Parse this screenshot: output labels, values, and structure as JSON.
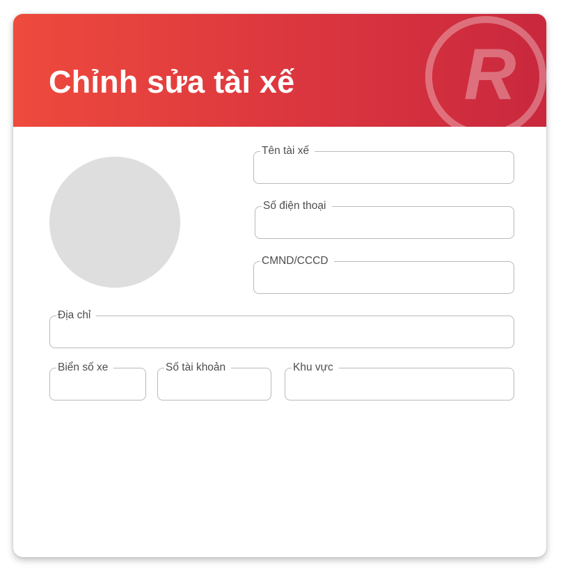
{
  "header": {
    "title": "Chỉnh sửa tài xế",
    "gradient_start": "#ee4a3d",
    "gradient_end": "#c9283d",
    "watermark_icon": "registered-r-icon",
    "watermark_letter": "R"
  },
  "avatar": {
    "placeholder_color": "#dedede"
  },
  "form": {
    "driver_name": {
      "label": "Tên tài xế",
      "value": ""
    },
    "phone": {
      "label": "Số điện thoại",
      "value": ""
    },
    "id_number": {
      "label": "CMND/CCCD",
      "value": ""
    },
    "address": {
      "label": "Địa chỉ",
      "value": ""
    },
    "license_plate": {
      "label": "Biển số xe",
      "value": ""
    },
    "account_number": {
      "label": "Số tài khoản",
      "value": ""
    },
    "region": {
      "label": "Khu vực",
      "value": ""
    }
  }
}
